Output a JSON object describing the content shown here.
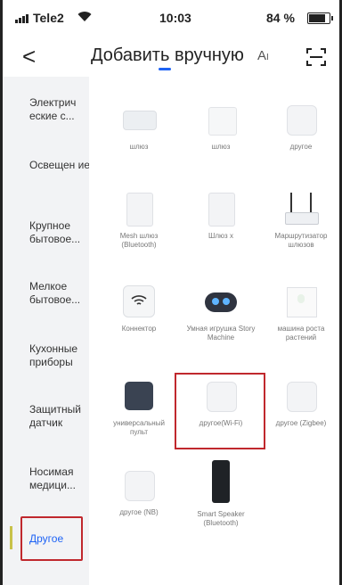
{
  "status_bar": {
    "carrier": "Tele2",
    "time": "10:03",
    "battery": "84 %"
  },
  "header": {
    "back": "<",
    "title": "Добавить вручную",
    "ai": "A",
    "scan_icon": "scan-icon"
  },
  "sidebar": {
    "items": [
      {
        "label": "Электрич еские с..."
      },
      {
        "label": "Освещен ие"
      },
      {
        "label": "Крупное бытовое..."
      },
      {
        "label": "Мелкое бытовое..."
      },
      {
        "label": "Кухонные приборы"
      },
      {
        "label": "Защитный датчик"
      },
      {
        "label": "Носимая медици..."
      },
      {
        "label": "Другое"
      }
    ],
    "selected": "Другое",
    "accent": "#1e63f5"
  },
  "devices": [
    {
      "label": "шлюз"
    },
    {
      "label": "шлюз"
    },
    {
      "label": "другое"
    },
    {
      "label": "Mesh шлюз (Bluetooth)"
    },
    {
      "label": "Шлюз  x"
    },
    {
      "label": "Маршрутизатор шлюзов"
    },
    {
      "label": "Коннектор"
    },
    {
      "label": "Умная игрушка Story Machine"
    },
    {
      "label": "машина роста растений"
    },
    {
      "label": "универсальный пульт"
    },
    {
      "label": "другое(Wi-Fi)"
    },
    {
      "label": "другое (Zigbee)"
    },
    {
      "label": "другое (NB)"
    },
    {
      "label": "Smart Speaker (Bluetooth)"
    }
  ],
  "highlight_color": "#c0282d"
}
